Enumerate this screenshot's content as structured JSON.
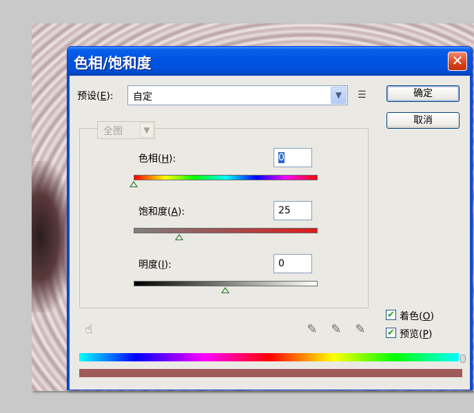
{
  "dialog": {
    "title": "色相/饱和度",
    "close_glyph": "✕"
  },
  "preset": {
    "label_prefix": "预设(",
    "label_key": "E",
    "label_suffix": "):",
    "value": "自定"
  },
  "buttons": {
    "ok": "确定",
    "cancel": "取消"
  },
  "channel": {
    "value": "全图"
  },
  "hue": {
    "label_prefix": "色相(",
    "label_key": "H",
    "label_suffix": "):",
    "value": "0",
    "level": 0
  },
  "saturation": {
    "label_prefix": "饱和度(",
    "label_key": "A",
    "label_suffix": "):",
    "value": "25",
    "level": 25
  },
  "lightness": {
    "label_prefix": "明度(",
    "label_key": "I",
    "label_suffix": "):",
    "value": "0",
    "level": 0
  },
  "options": {
    "colorize_prefix": "着色(",
    "colorize_key": "O",
    "colorize_suffix": ")",
    "colorize_checked": true,
    "preview_prefix": "预览(",
    "preview_key": "P",
    "preview_suffix": ")",
    "preview_checked": true,
    "check_glyph": "✔"
  },
  "icons": {
    "dropdown": "▼",
    "menu": "☰",
    "hand": "☝",
    "eyedropper": "✎",
    "eyedropper_plus": "✎",
    "eyedropper_minus": "✎"
  },
  "colors": {
    "title_bar": "#0054e3",
    "dialog_bg": "#ebe9e4",
    "result_bar": "#a05a5a"
  }
}
